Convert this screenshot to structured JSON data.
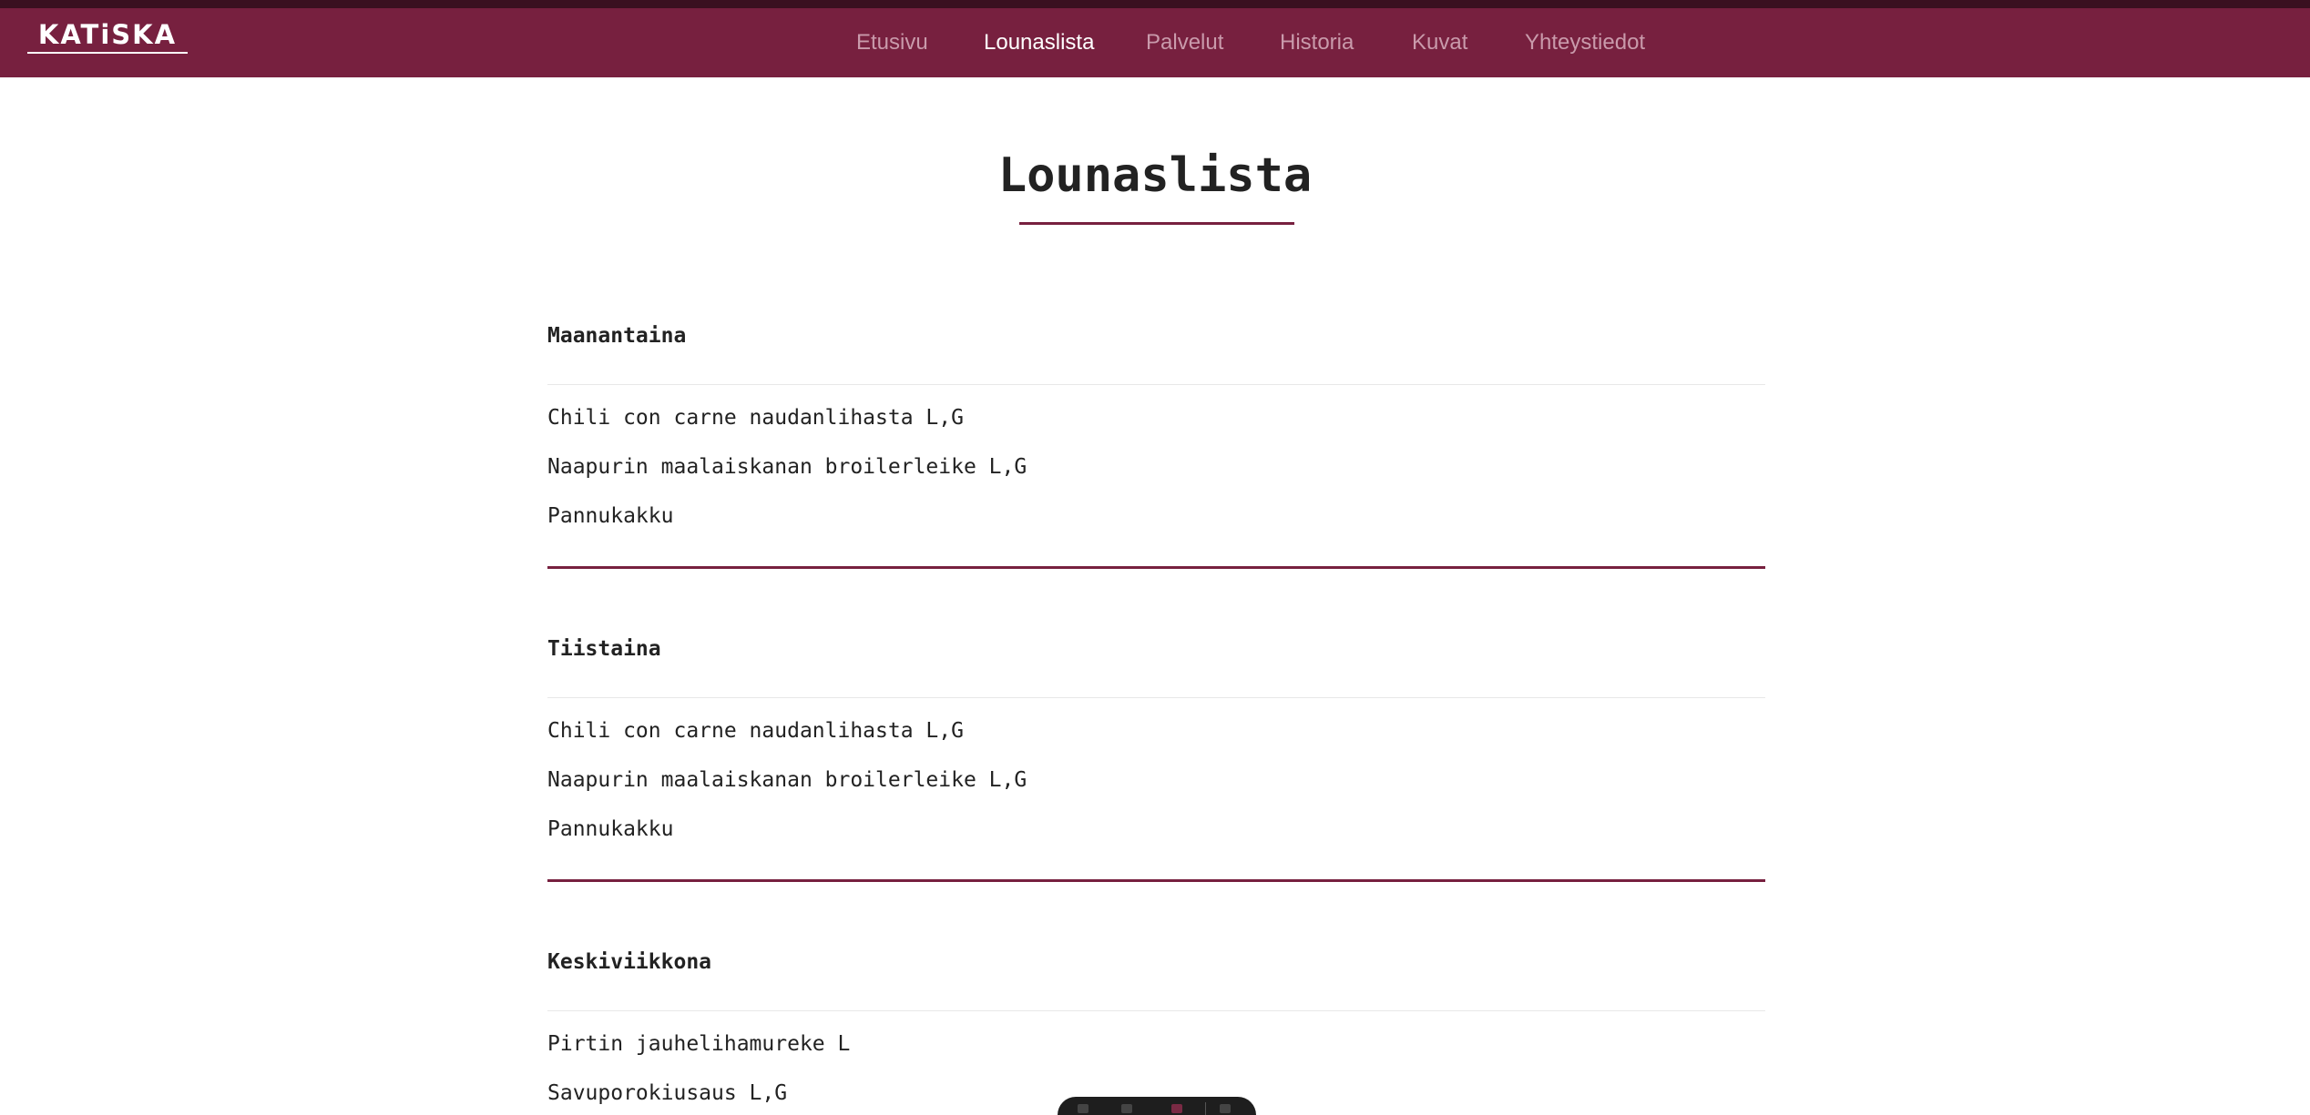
{
  "header": {
    "logo_text": "KATiSKA",
    "nav": [
      {
        "label": "Etusivu",
        "active": false
      },
      {
        "label": "Lounaslista",
        "active": true
      },
      {
        "label": "Palvelut",
        "active": false
      },
      {
        "label": "Historia",
        "active": false
      },
      {
        "label": "Kuvat",
        "active": false
      },
      {
        "label": "Yhteystiedot",
        "active": false
      }
    ],
    "colors": {
      "nav_bg": "#77203f",
      "top_strip": "#3a1020",
      "nav_text": "#c99aab",
      "nav_active": "#ffffff"
    }
  },
  "main": {
    "title": "Lounaslista",
    "days": [
      {
        "name": "Maanantaina",
        "dishes": [
          "Chili con carne naudanlihasta L,G",
          "Naapurin maalaiskanan broilerleike L,G",
          "Pannukakku"
        ]
      },
      {
        "name": "Tiistaina",
        "dishes": [
          "Chili con carne naudanlihasta L,G",
          "Naapurin maalaiskanan broilerleike L,G",
          "Pannukakku"
        ]
      },
      {
        "name": "Keskiviikkona",
        "dishes": [
          "Pirtin jauhelihamureke L",
          "Savuporokiusaus L,G"
        ]
      }
    ],
    "accent_color": "#77203f"
  }
}
